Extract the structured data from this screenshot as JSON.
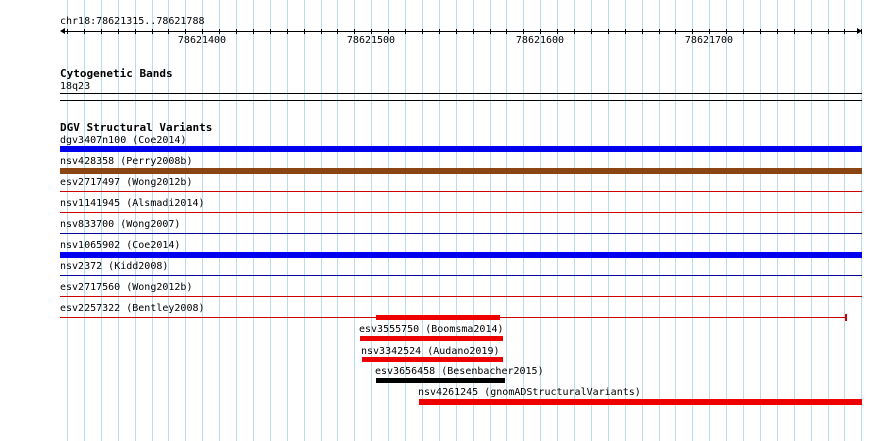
{
  "ruler": {
    "coords_label": "chr18:78621315..78621788",
    "start": 78621315,
    "end": 78621788,
    "tick_labels": [
      "78621400",
      "78621500",
      "78621600",
      "78621700"
    ]
  },
  "cytoband_track": {
    "title": "Cytogenetic Bands",
    "band": "18q23"
  },
  "dgv_track": {
    "title": "DGV Structural Variants",
    "features": [
      {
        "id": "dgv3407n100",
        "source": "Coe2014",
        "color": "#0000ee",
        "thick": true
      },
      {
        "id": "nsv428358",
        "source": "Perry2008b",
        "color": "#8b4513",
        "thick": true
      },
      {
        "id": "esv2717497",
        "source": "Wong2012b",
        "color": "#cc0000",
        "thick": false
      },
      {
        "id": "nsv1141945",
        "source": "Alsmadi2014",
        "color": "#cc0000",
        "thick": false
      },
      {
        "id": "nsv833700",
        "source": "Wong2007",
        "color": "#000099",
        "thick": false
      },
      {
        "id": "nsv1065902",
        "source": "Coe2014",
        "color": "#0000ee",
        "thick": true
      },
      {
        "id": "nsv2372",
        "source": "Kidd2008",
        "color": "#000099",
        "thick": false
      },
      {
        "id": "esv2717560",
        "source": "Wong2012b",
        "color": "#cc0000",
        "thick": false
      },
      {
        "id": "esv2257322",
        "source": "Bentley2008",
        "color": "#cc0000",
        "thick": false
      },
      {
        "id": "esv3555750",
        "source": "Boomsma2014",
        "color": "#ee0000",
        "thick": true
      },
      {
        "id": "nsv3342524",
        "source": "Audano2019",
        "color": "#ee0000",
        "thick": true
      },
      {
        "id": "esv3656458",
        "source": "Besenbacher2015",
        "color": "#000000",
        "thick": true
      },
      {
        "id": "nsv4261245",
        "source": "gnomADStructuralVariants",
        "color": "#ee0000",
        "thick": true
      }
    ]
  }
}
